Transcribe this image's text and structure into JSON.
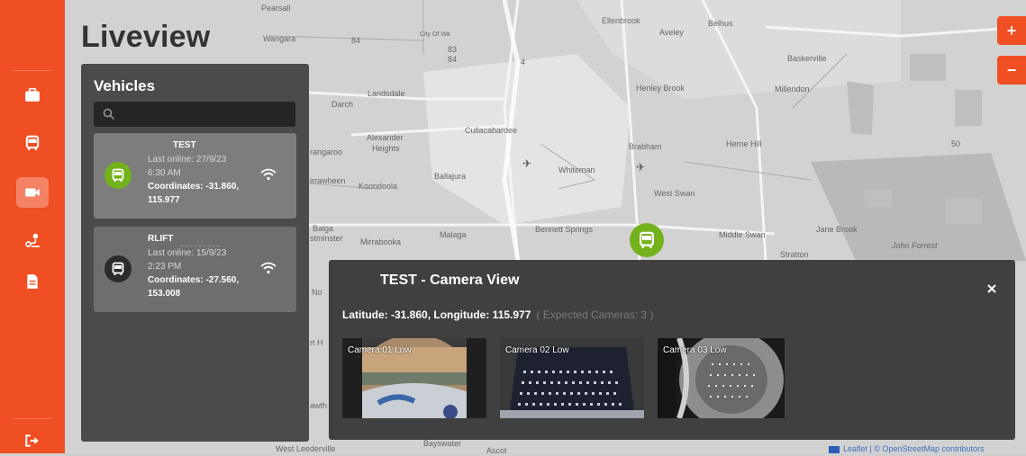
{
  "page": {
    "title": "Liveview"
  },
  "nav": {
    "items": [
      {
        "name": "briefcase-icon",
        "active": false
      },
      {
        "name": "bus-icon",
        "active": false
      },
      {
        "name": "video-camera-icon",
        "active": true
      },
      {
        "name": "route-icon",
        "active": false
      },
      {
        "name": "document-icon",
        "active": false
      }
    ],
    "logout_icon": "sign-out-icon"
  },
  "vehicles_panel": {
    "title": "Vehicles",
    "search_placeholder": "",
    "vehicles": [
      {
        "name": "TEST",
        "last_online_line1": "Last online: 27/9/23",
        "last_online_line2": "6:30 AM",
        "coordinates_line1": "Coordinates: -31.860,",
        "coordinates_line2": "115.977",
        "status_color": "#74b21d",
        "selected": true
      },
      {
        "name": "RLIFT",
        "last_online_line1": "Last online: 15/9/23",
        "last_online_line2": "2:23 PM",
        "coordinates_line1": "Coordinates: -27.560,",
        "coordinates_line2": "153.008",
        "status_color": "#2b2b2b",
        "selected": false
      }
    ]
  },
  "map": {
    "zoom_in": "+",
    "zoom_out": "−",
    "labels": [
      "Pearsall",
      "Wangara",
      "84",
      "83",
      "84",
      "4",
      "City Of Wa",
      "Ellenbrook",
      "Aveley",
      "Belhus",
      "Baskerville",
      "Henley Brook",
      "Millendon",
      "Landsdale",
      "Darch",
      "Cullacabardee",
      "Alexander",
      "Heights",
      "Koondoola",
      "Ballajura",
      "Whiteman",
      "Brabham",
      "Herne Hill",
      "West Swan",
      "50",
      "Bennett Springs",
      "Malaga",
      "Mirrabooka",
      "Balga",
      "Middle Swan",
      "Jane Brook",
      "Stratton",
      "John Forrest",
      "rangaroo",
      "irrawheen",
      "stminster",
      "No",
      "rt H",
      "awth",
      "West Leederville",
      "Bayswater",
      "Ascot"
    ],
    "attribution": "Leaflet | © OpenStreetMap contributors"
  },
  "camera_dialog": {
    "title": "TEST - Camera View",
    "latitude_label": "Latitude: -31.860, Longitude: 115.977",
    "expected_cameras": "( Expected Cameras: 3 )",
    "close_label": "×",
    "cameras": [
      {
        "label": "Camera 01 Low"
      },
      {
        "label": "Camera 02 Low"
      },
      {
        "label": "Camera 03 Low"
      }
    ]
  }
}
